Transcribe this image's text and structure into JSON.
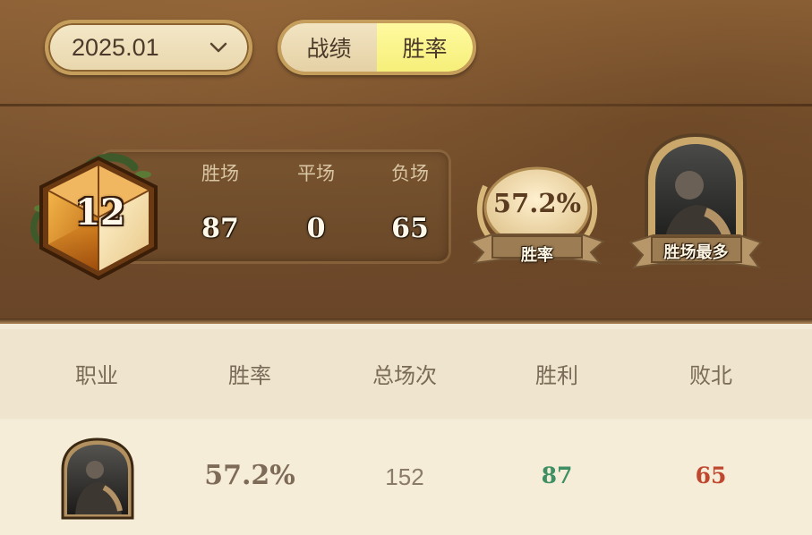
{
  "filters": {
    "month": "2025.01",
    "tabs": [
      {
        "label": "战绩",
        "active": false
      },
      {
        "label": "胜率",
        "active": true
      }
    ]
  },
  "summary": {
    "rank": "12",
    "labels": {
      "wins": "胜场",
      "ties": "平场",
      "losses": "负场"
    },
    "values": {
      "wins": "87",
      "ties": "0",
      "losses": "65"
    },
    "winrate_value": "57.2%",
    "winrate_label": "胜率",
    "most_wins_label": "胜场最多"
  },
  "table": {
    "headers": [
      "职业",
      "胜率",
      "总场次",
      "胜利",
      "败北"
    ],
    "rows": [
      {
        "winrate": "57.2%",
        "total": "152",
        "wins": "87",
        "losses": "65"
      }
    ]
  },
  "colors": {
    "wins": "#3e8f63",
    "losses": "#c0472f",
    "active_tab": "#f6ef7a"
  }
}
